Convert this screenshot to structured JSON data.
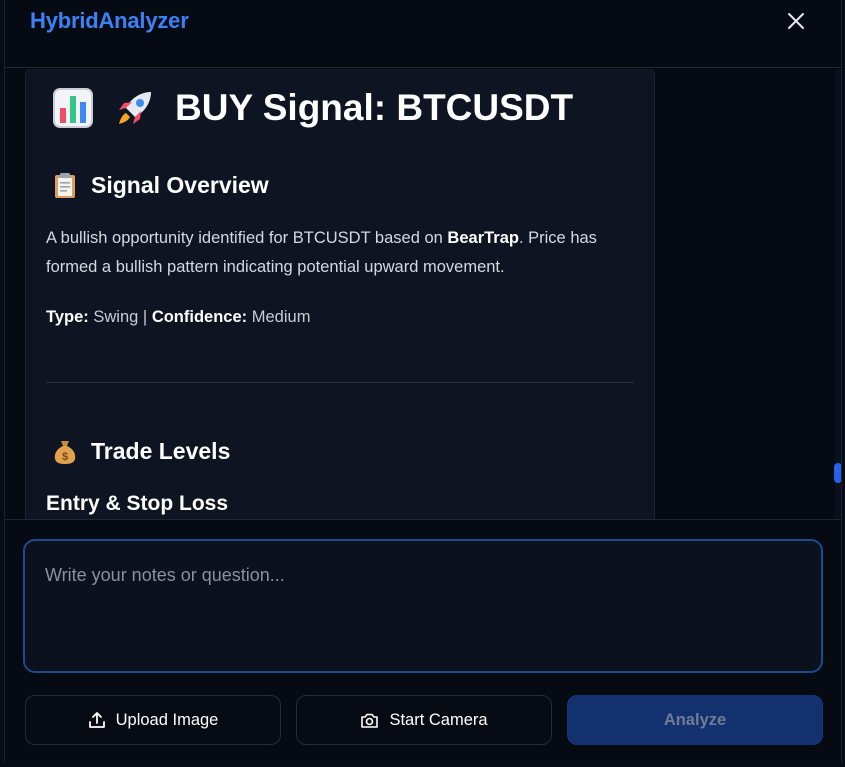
{
  "app": {
    "title": "HybridAnalyzer"
  },
  "signal": {
    "title": "BUY Signal: BTCUSDT",
    "icons": [
      "bar-chart-emoji",
      "rocket-emoji"
    ],
    "overview": {
      "heading": "Signal Overview",
      "heading_icon": "clipboard-emoji",
      "text_before": "A bullish opportunity identified for BTCUSDT based on ",
      "pattern": "BearTrap",
      "text_after": ". Price has formed a bullish pattern indicating potential upward movement.",
      "type_label": "Type:",
      "type_value": "Swing",
      "separator": "|",
      "confidence_label": "Confidence:",
      "confidence_value": "Medium"
    },
    "trade_levels": {
      "heading": "Trade Levels",
      "heading_icon": "money-bag-emoji",
      "subheading": "Entry & Stop Loss"
    }
  },
  "input": {
    "placeholder": "Write your notes or question...",
    "value": ""
  },
  "actions": {
    "upload_label": "Upload Image",
    "upload_icon": "upload-icon",
    "camera_label": "Start Camera",
    "camera_icon": "camera-icon",
    "analyze_label": "Analyze"
  },
  "colors": {
    "accent": "#3b82f6",
    "primary_button": "#13306f",
    "card_bg": "#0f1422",
    "page_bg": "#060a13"
  }
}
